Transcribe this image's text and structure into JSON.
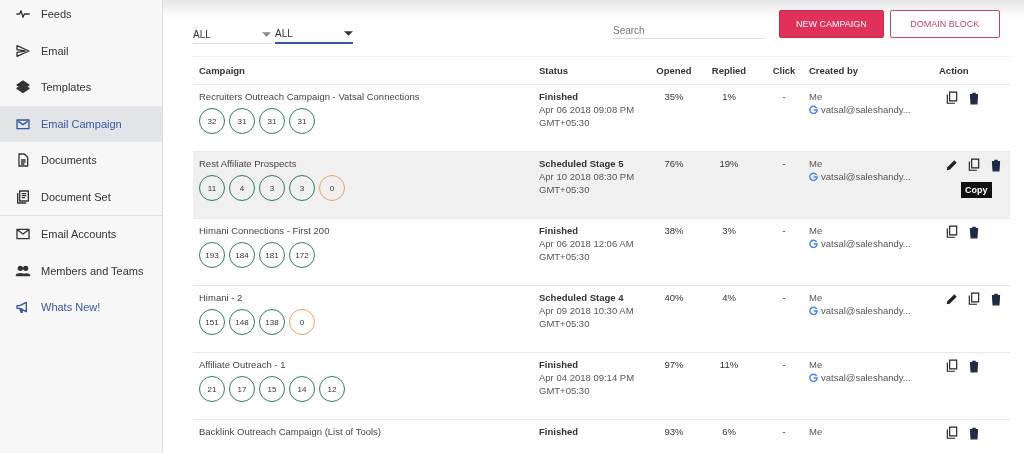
{
  "sidebar": {
    "sections": [
      [
        {
          "label": "Feeds",
          "kind": "pulse",
          "selected": false
        },
        {
          "label": "Email",
          "kind": "send",
          "selected": false
        },
        {
          "label": "Templates",
          "kind": "layers",
          "selected": false
        },
        {
          "label": "Email Campaign",
          "kind": "mailbox",
          "selected": true
        },
        {
          "label": "Documents",
          "kind": "doc",
          "selected": false
        },
        {
          "label": "Document Set",
          "kind": "docs",
          "selected": false
        }
      ],
      [
        {
          "label": "Email Accounts",
          "kind": "mail",
          "selected": false
        },
        {
          "label": "Members and Teams",
          "kind": "people",
          "selected": false
        },
        {
          "label": "Whats New!",
          "kind": "megaphone",
          "selected": false
        }
      ]
    ]
  },
  "filters": [
    {
      "value": "ALL",
      "focused": false
    },
    {
      "value": "ALL",
      "focused": true
    }
  ],
  "search": {
    "placeholder": "Search"
  },
  "buttons": [
    {
      "label": "NEW CAMPAIGN",
      "kind": "primary"
    },
    {
      "label": "DOMAIN BLOCK",
      "kind": "outline"
    }
  ],
  "table": {
    "columns": [
      "Campaign",
      "Status",
      "Opened",
      "Replied",
      "Click",
      "Created by",
      "Action"
    ],
    "rows": [
      {
        "name": "Recruiters Outreach Campaign - Vatsal Connections",
        "counts": [
          {
            "value": "32",
            "color": "#2e7d5b"
          },
          {
            "value": "31",
            "color": "#2e7d5b"
          },
          {
            "value": "31",
            "color": "#2e7d5b"
          },
          {
            "value": "31",
            "color": "#2e7d5b"
          }
        ],
        "status": "Finished",
        "date": "Apr 06 2018 09:08 PM",
        "tz": "GMT+05:30",
        "opened": "35%",
        "replied": "1%",
        "click": "-",
        "creator": "Me",
        "email": "vatsal@saleshandy...",
        "editable": false,
        "highlighted": false
      },
      {
        "name": "Rest Affiliate Prospects",
        "counts": [
          {
            "value": "11",
            "color": "#2e7d5b"
          },
          {
            "value": "4",
            "color": "#2e7d5b"
          },
          {
            "value": "3",
            "color": "#2e7d5b"
          },
          {
            "value": "3",
            "color": "#2e7d5b"
          },
          {
            "value": "0",
            "color": "#e8a25c"
          }
        ],
        "status": "Scheduled Stage 5",
        "date": "Apr 10 2018 08:30 PM",
        "tz": "GMT+05:30",
        "opened": "76%",
        "replied": "19%",
        "click": "-",
        "creator": "Me",
        "email": "vatsal@saleshandy...",
        "editable": true,
        "highlighted": true,
        "tooltip": "Copy"
      },
      {
        "name": "Himani Connections - First 200",
        "counts": [
          {
            "value": "193",
            "color": "#2e7d5b"
          },
          {
            "value": "184",
            "color": "#2e7d5b"
          },
          {
            "value": "181",
            "color": "#2e7d5b"
          },
          {
            "value": "172",
            "color": "#2e7d5b"
          }
        ],
        "status": "Finished",
        "date": "Apr 06 2018 12:06 AM",
        "tz": "GMT+05:30",
        "opened": "38%",
        "replied": "3%",
        "click": "-",
        "creator": "Me",
        "email": "vatsal@saleshandy...",
        "editable": false,
        "highlighted": false
      },
      {
        "name": "Himani - 2",
        "counts": [
          {
            "value": "151",
            "color": "#2e7d5b"
          },
          {
            "value": "148",
            "color": "#2e7d5b"
          },
          {
            "value": "138",
            "color": "#2e7d5b"
          },
          {
            "value": "0",
            "color": "#e8a25c"
          }
        ],
        "status": "Scheduled Stage 4",
        "date": "Apr 09 2018 10:30 AM",
        "tz": "GMT+05:30",
        "opened": "40%",
        "replied": "4%",
        "click": "-",
        "creator": "Me",
        "email": "vatsal@saleshandy...",
        "editable": true,
        "highlighted": false
      },
      {
        "name": "Affiliate Outreach - 1",
        "counts": [
          {
            "value": "21",
            "color": "#2e7d5b"
          },
          {
            "value": "17",
            "color": "#2e7d5b"
          },
          {
            "value": "15",
            "color": "#2e7d5b"
          },
          {
            "value": "14",
            "color": "#2e7d5b"
          },
          {
            "value": "12",
            "color": "#2e7d5b"
          }
        ],
        "status": "Finished",
        "date": "Apr 04 2018 09:14 PM",
        "tz": "GMT+05:30",
        "opened": "97%",
        "replied": "11%",
        "click": "-",
        "creator": "Me",
        "email": "vatsal@saleshandy...",
        "editable": false,
        "highlighted": false
      },
      {
        "name": "Backlink Outreach Campaign (List of Tools)",
        "status": "Finished",
        "opened": "93%",
        "replied": "6%",
        "click": "-",
        "creator": "Me",
        "editable": false,
        "highlighted": false
      }
    ]
  }
}
